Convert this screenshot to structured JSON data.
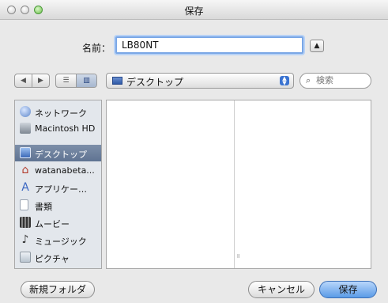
{
  "window": {
    "title": "保存"
  },
  "save_form": {
    "name_label": "名前：",
    "name_value": "LB80NT",
    "expand_icon": "triangle-up-icon"
  },
  "toolbar": {
    "back_icon": "◀",
    "forward_icon": "▶",
    "list_view_icon": "☰",
    "column_view_icon": "▥",
    "location": "デスクトップ",
    "search_placeholder": "検索"
  },
  "sidebar": {
    "items": [
      {
        "label": "ネットワーク",
        "icon": "globe-icon"
      },
      {
        "label": "Macintosh HD",
        "icon": "hard-drive-icon"
      },
      {
        "label": "デスクトップ",
        "icon": "desktop-icon",
        "selected": true
      },
      {
        "label": "watanabeta...",
        "icon": "home-icon"
      },
      {
        "label": "アプリケー…",
        "icon": "applications-icon"
      },
      {
        "label": "書類",
        "icon": "documents-icon"
      },
      {
        "label": "ムービー",
        "icon": "movies-icon"
      },
      {
        "label": "ミュージック",
        "icon": "music-icon"
      },
      {
        "label": "ピクチャ",
        "icon": "pictures-icon"
      }
    ]
  },
  "buttons": {
    "new_folder": "新規フォルダ",
    "cancel": "キャンセル",
    "save": "保存"
  },
  "colors": {
    "accent": "#5a9be7",
    "selection": "#6e82a0"
  }
}
